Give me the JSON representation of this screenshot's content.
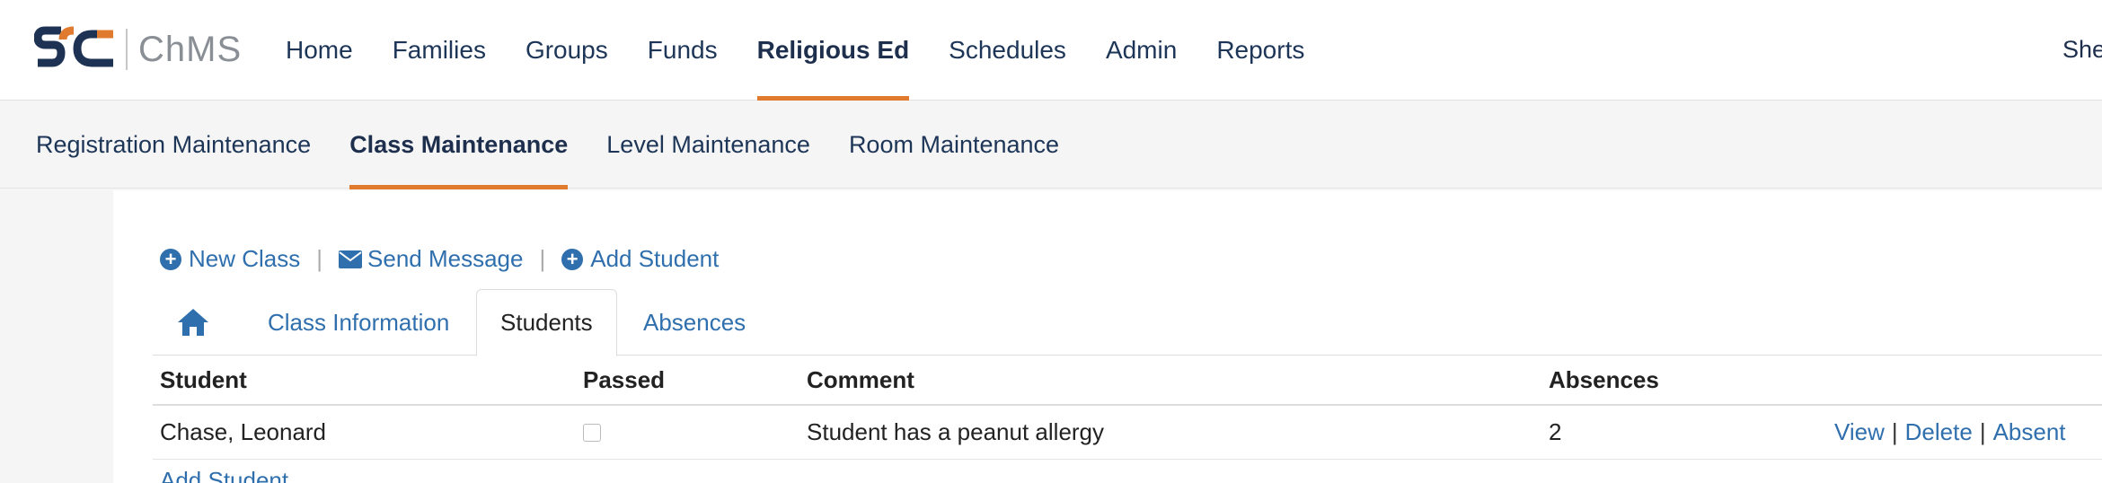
{
  "app": {
    "logo_text": "ChMS",
    "user_name": "Shelly"
  },
  "main_nav": [
    {
      "label": "Home",
      "active": false
    },
    {
      "label": "Families",
      "active": false
    },
    {
      "label": "Groups",
      "active": false
    },
    {
      "label": "Funds",
      "active": false
    },
    {
      "label": "Religious Ed",
      "active": true
    },
    {
      "label": "Schedules",
      "active": false
    },
    {
      "label": "Admin",
      "active": false
    },
    {
      "label": "Reports",
      "active": false
    }
  ],
  "sub_nav": [
    {
      "label": "Registration Maintenance",
      "active": false
    },
    {
      "label": "Class Maintenance",
      "active": true
    },
    {
      "label": "Level Maintenance",
      "active": false
    },
    {
      "label": "Room Maintenance",
      "active": false
    }
  ],
  "actions": {
    "new_class": "New Class",
    "send_message": "Send Message",
    "add_student": "Add Student",
    "separator": "|"
  },
  "tabs": {
    "home_icon": "home-icon",
    "class_information": "Class Information",
    "students": "Students",
    "absences": "Absences"
  },
  "table": {
    "headers": {
      "student": "Student",
      "passed": "Passed",
      "comment": "Comment",
      "absences": "Absences"
    },
    "rows": [
      {
        "student": "Chase, Leonard",
        "passed": false,
        "comment": "Student has a peanut allergy",
        "absences": "2",
        "links": {
          "view": "View",
          "delete": "Delete",
          "absent": "Absent",
          "pipe": "|"
        }
      }
    ],
    "add_student_link": "Add Student"
  },
  "colors": {
    "accent": "#e07a2e",
    "link": "#2f6fad",
    "nav_text": "#1d3557",
    "logo_navy": "#1e3354"
  }
}
